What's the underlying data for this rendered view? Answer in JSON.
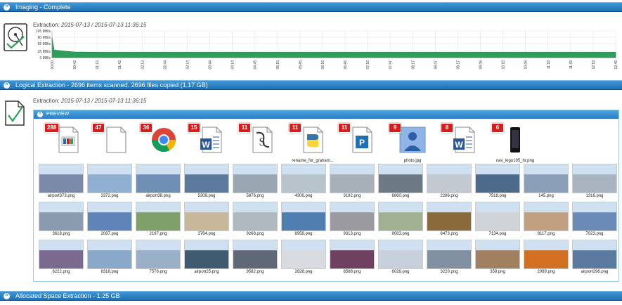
{
  "imaging": {
    "bar_title": "Imaging - Complete",
    "extraction_label": "Extraction:",
    "extraction_range": "2015-07-13 / 2015-07-13 11:36:15",
    "y_ticks": [
      "105 MB/s",
      "80 MB/s",
      "55 MB/s",
      "25 MB/s",
      "0 MB/s"
    ],
    "x_ticks": [
      "00:00",
      "00:42",
      "01:12",
      "01:43",
      "02:13",
      "02:44",
      "03:14",
      "03:44",
      "04:14",
      "04:45",
      "05:15",
      "05:45",
      "06:16",
      "06:46",
      "07:16",
      "07:47",
      "08:17",
      "08:47",
      "09:17",
      "09:48",
      "10:18",
      "10:48",
      "11:18",
      "11:49",
      "12:19",
      "12:49"
    ]
  },
  "logical": {
    "bar_title": "Logical Extraction - 2696 items scanned. 2696 files copied (1.17 GB)",
    "extraction_label": "Extraction:",
    "extraction_range": "2015-07-13 / 2015-07-13 11:36:15",
    "preview_title": "PREVIEW",
    "file_types": [
      {
        "count": "288",
        "icon": "image-doc-icon",
        "label": ""
      },
      {
        "count": "47",
        "icon": "blank-file-icon",
        "label": ""
      },
      {
        "count": "36",
        "icon": "chrome-icon",
        "label": ""
      },
      {
        "count": "15",
        "icon": "word-doc-icon",
        "label": ""
      },
      {
        "count": "11",
        "icon": "script-icon",
        "label": ""
      },
      {
        "count": "11",
        "icon": "python-icon",
        "label": "rename_for_graham..."
      },
      {
        "count": "11",
        "icon": "publisher-icon",
        "label": ""
      },
      {
        "count": "9",
        "icon": "photo-icon",
        "label": "photo.jpg"
      },
      {
        "count": "8",
        "icon": "word-doc-icon",
        "label": ""
      },
      {
        "count": "6",
        "icon": "phone-image-icon",
        "label": "nav_logo195_hr.png"
      }
    ],
    "thumbnails": [
      [
        "airport373.png",
        "3372.png",
        "airport38.png",
        "5308.png",
        "5876.png",
        "4306.png",
        "3192.png",
        "6860.png",
        "2286.png",
        "7518.png",
        "145.png",
        "1316.png"
      ],
      [
        "3618.png",
        "2087.png",
        "2197.png",
        "3764.png",
        "9268.png",
        "8958.png",
        "9313.png",
        "9083.png",
        "6473.png",
        "7134.png",
        "8117.png",
        "7023.png"
      ],
      [
        "6222.png",
        "8318.png",
        "7576.png",
        "airport25.png",
        "9582.png",
        "2828.png",
        "8588.png",
        "6026.png",
        "3220.png",
        "359.png",
        "2099.png",
        "airport296.png"
      ]
    ],
    "thumb_colors": [
      [
        "#7a8aa8",
        "#8fb0d0",
        "#6f8fb5",
        "#5b7a9c",
        "#9aa7b2",
        "#b8c4cc",
        "#a7b0b8",
        "#6d7a86",
        "#c2c9d0",
        "#4d6a8a",
        "#8aa0b8",
        "#aab4c0"
      ],
      [
        "#8a9bb0",
        "#5f84b8",
        "#7fa06a",
        "#c9b79a",
        "#b0b8c0",
        "#4f7fb0",
        "#9a9aa0",
        "#a0b090",
        "#8a6a3a",
        "#d0d4d8",
        "#c0a080",
        "#6a8ab8"
      ],
      [
        "#7a6a90",
        "#8aa8c8",
        "#9ab0c8",
        "#405a70",
        "#606878",
        "#d8dce0",
        "#704060",
        "#c8d0dc",
        "#8090a0",
        "#a08060",
        "#d07020",
        "#5a7aa0"
      ]
    ]
  },
  "allocated": {
    "bar_title": "Allocated Space Extraction - 1.25 GB"
  },
  "colors": {
    "accent": "#1f6fb3",
    "chart_fill": "#2f9e5a",
    "badge": "#d91b1b"
  },
  "chart_data": {
    "type": "area",
    "title": "",
    "xlabel": "",
    "ylabel": "",
    "ylim": [
      0,
      105
    ],
    "x": [
      "00:00",
      "00:42",
      "01:12",
      "01:43",
      "02:13",
      "02:44",
      "03:14",
      "03:44",
      "04:14",
      "04:45",
      "05:15",
      "05:45",
      "06:16",
      "06:46",
      "07:16",
      "07:47",
      "08:17",
      "08:47",
      "09:17",
      "09:48",
      "10:18",
      "10:48",
      "11:18",
      "11:49",
      "12:19",
      "12:49"
    ],
    "series": [
      {
        "values": [
          80,
          22,
          21,
          21,
          21,
          21,
          21,
          21,
          21,
          21,
          21,
          21,
          21,
          21,
          21,
          21,
          21,
          21,
          21,
          21,
          21,
          21,
          21,
          21,
          21,
          21
        ]
      }
    ]
  }
}
